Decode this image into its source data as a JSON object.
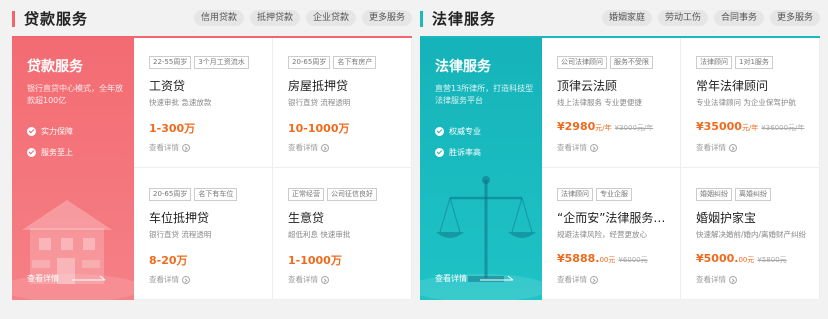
{
  "colors": {
    "loan_accent": "#f4646f",
    "legal_accent": "#1bb9bf",
    "price": "#f06a1d"
  },
  "loan": {
    "title": "贷款服务",
    "tags": [
      "信用贷款",
      "抵押贷款",
      "企业贷款",
      "更多服务"
    ],
    "hero": {
      "title": "贷款服务",
      "desc": "银行直贷中心模式，全年放款超100亿",
      "features": [
        "实力保障",
        "服务至上"
      ],
      "more": "查看详情"
    },
    "cards": [
      {
        "tags": [
          "22-55周岁",
          "3个月工资流水"
        ],
        "title": "工资贷",
        "desc": "快速审批 急速放款",
        "price": "1-300万",
        "more": "查看详情"
      },
      {
        "tags": [
          "20-65周岁",
          "名下有房产"
        ],
        "title": "房屋抵押贷",
        "desc": "银行直贷 流程透明",
        "price": "10-1000万",
        "more": "查看详情"
      },
      {
        "tags": [
          "20-65周岁",
          "名下有车位"
        ],
        "title": "车位抵押贷",
        "desc": "银行直贷 流程透明",
        "price": "8-20万",
        "more": "查看详情"
      },
      {
        "tags": [
          "正常经营",
          "公司征信良好"
        ],
        "title": "生意贷",
        "desc": "超低利息 快速审批",
        "price": "1-1000万",
        "more": "查看详情"
      }
    ]
  },
  "legal": {
    "title": "法律服务",
    "tags": [
      "婚姻家庭",
      "劳动工伤",
      "合同事务",
      "更多服务"
    ],
    "hero": {
      "title": "法律服务",
      "desc": "直营13所律所，打造科技型法律服务平台",
      "features": [
        "权威专业",
        "胜诉率高"
      ],
      "more": "查看详情"
    },
    "cards": [
      {
        "tags": [
          "公司法律顾问",
          "服务不受限"
        ],
        "title": "顶律云法顾",
        "desc": "线上法律服务 专业更便捷",
        "price": "¥2980",
        "unit": "元/年",
        "old": "¥3000元/年",
        "more": "查看详情"
      },
      {
        "tags": [
          "法律顾问",
          "1对1服务"
        ],
        "title": "常年法律顾问",
        "desc": "专业法律顾问 为企业保驾护航",
        "price": "¥35000",
        "unit": "元/年",
        "old": "¥36000元/年",
        "more": "查看详情"
      },
      {
        "tags": [
          "法律顾问",
          "专业企服"
        ],
        "title": "“企而安”法律服务…",
        "desc": "规避法律风险，经营更放心",
        "price": "¥5888.",
        "unit": "00元",
        "old": "¥6000元",
        "more": "查看详情"
      },
      {
        "tags": [
          "婚姻纠纷",
          "离婚纠纷"
        ],
        "title": "婚姻护家宝",
        "desc": "快速解决婚前/婚内/离婚财产纠纷",
        "price": "¥5000.",
        "unit": "00元",
        "old": "¥5800元",
        "more": "查看详情"
      }
    ]
  }
}
